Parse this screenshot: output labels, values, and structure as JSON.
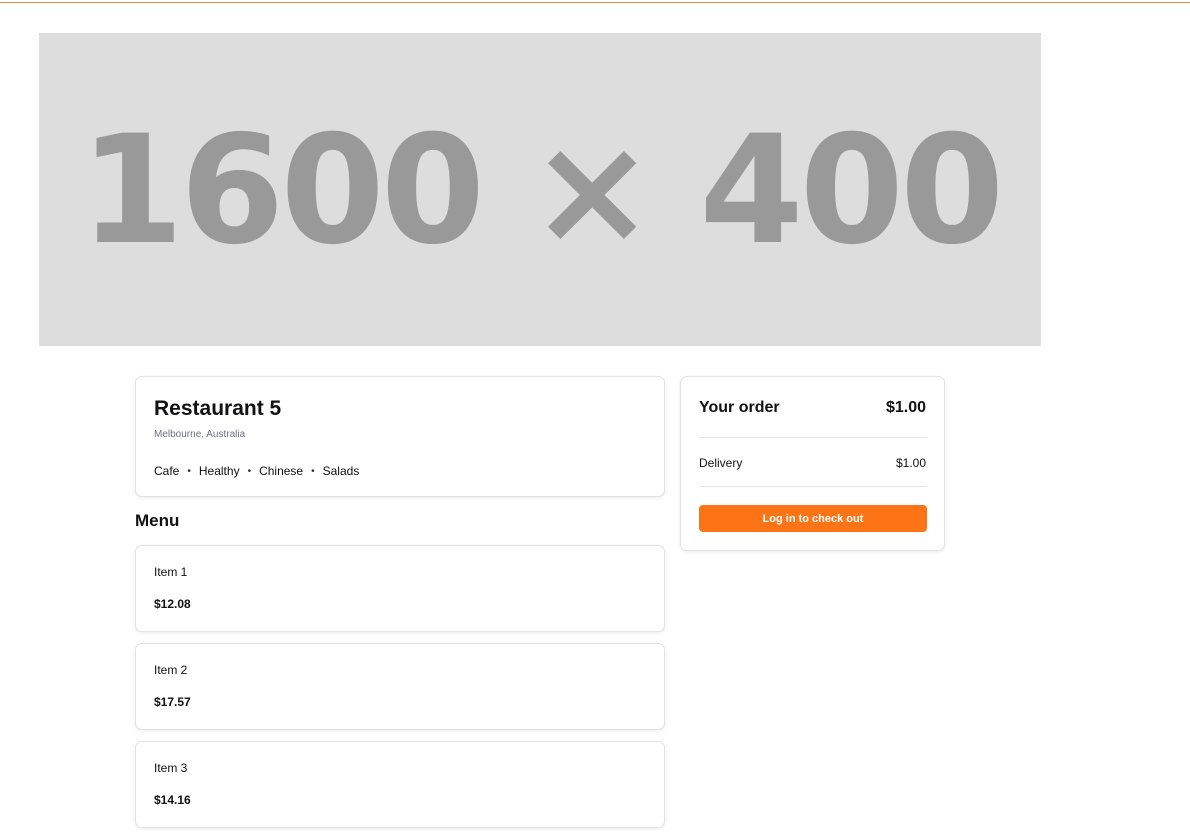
{
  "hero": {
    "placeholder_text": "1600 × 400"
  },
  "restaurant": {
    "name": "Restaurant 5",
    "location": "Melbourne, Australia",
    "tags": [
      "Cafe",
      "Healthy",
      "Chinese",
      "Salads"
    ],
    "tag_separator": "•"
  },
  "menu": {
    "heading": "Menu",
    "items": [
      {
        "name": "Item 1",
        "price": "$12.08"
      },
      {
        "name": "Item 2",
        "price": "$17.57"
      },
      {
        "name": "Item 3",
        "price": "$14.16"
      }
    ]
  },
  "order": {
    "title": "Your order",
    "total": "$1.00",
    "delivery_label": "Delivery",
    "delivery_value": "$1.00",
    "checkout_label": "Log in to check out"
  },
  "colors": {
    "accent": "#fd7416",
    "top_line": "#f0883a",
    "hero_background": "#dddddd",
    "hero_text": "#999999"
  }
}
